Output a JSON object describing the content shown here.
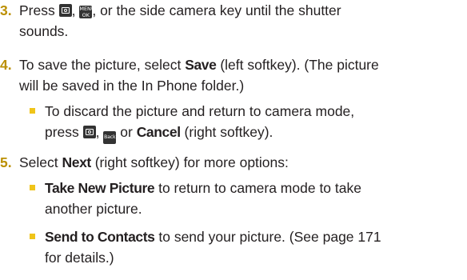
{
  "steps": [
    {
      "number": "3.",
      "text_a": "Press ",
      "text_b": ", ",
      "text_c": ", or the side camera key until the shutter",
      "text_d": "sounds."
    },
    {
      "number": "4.",
      "text_a": "To save the picture, select ",
      "bold_a": "Save",
      "text_b": " (left softkey). (The picture",
      "text_c": "will be saved in the In Phone folder.)",
      "bullets": [
        {
          "line1": "To discard the picture and return to camera mode,",
          "text_a": "press ",
          "text_b": ", ",
          "text_c": " or ",
          "bold_a": "Cancel",
          "text_d": " (right softkey)."
        }
      ]
    },
    {
      "number": "5.",
      "text_a": "Select ",
      "bold_a": "Next",
      "text_b": " (right softkey) for more options:",
      "bullets": [
        {
          "bold_a": "Take New Picture",
          "text_a": " to return to camera mode to take",
          "line2": "another picture."
        },
        {
          "bold_a": "Send to Contacts",
          "text_a": " to send your picture. (See page 171",
          "line2": "for details.)"
        }
      ]
    }
  ],
  "keys": {
    "camera_icon": "camera-key-icon",
    "menu_ok_line1": "MENU",
    "menu_ok_line2": "OK",
    "back_label": "Back"
  },
  "colors": {
    "step_number": "#bb8f00",
    "bullet": "#f0c419",
    "text": "#231f20",
    "key_bg": "#333333"
  }
}
